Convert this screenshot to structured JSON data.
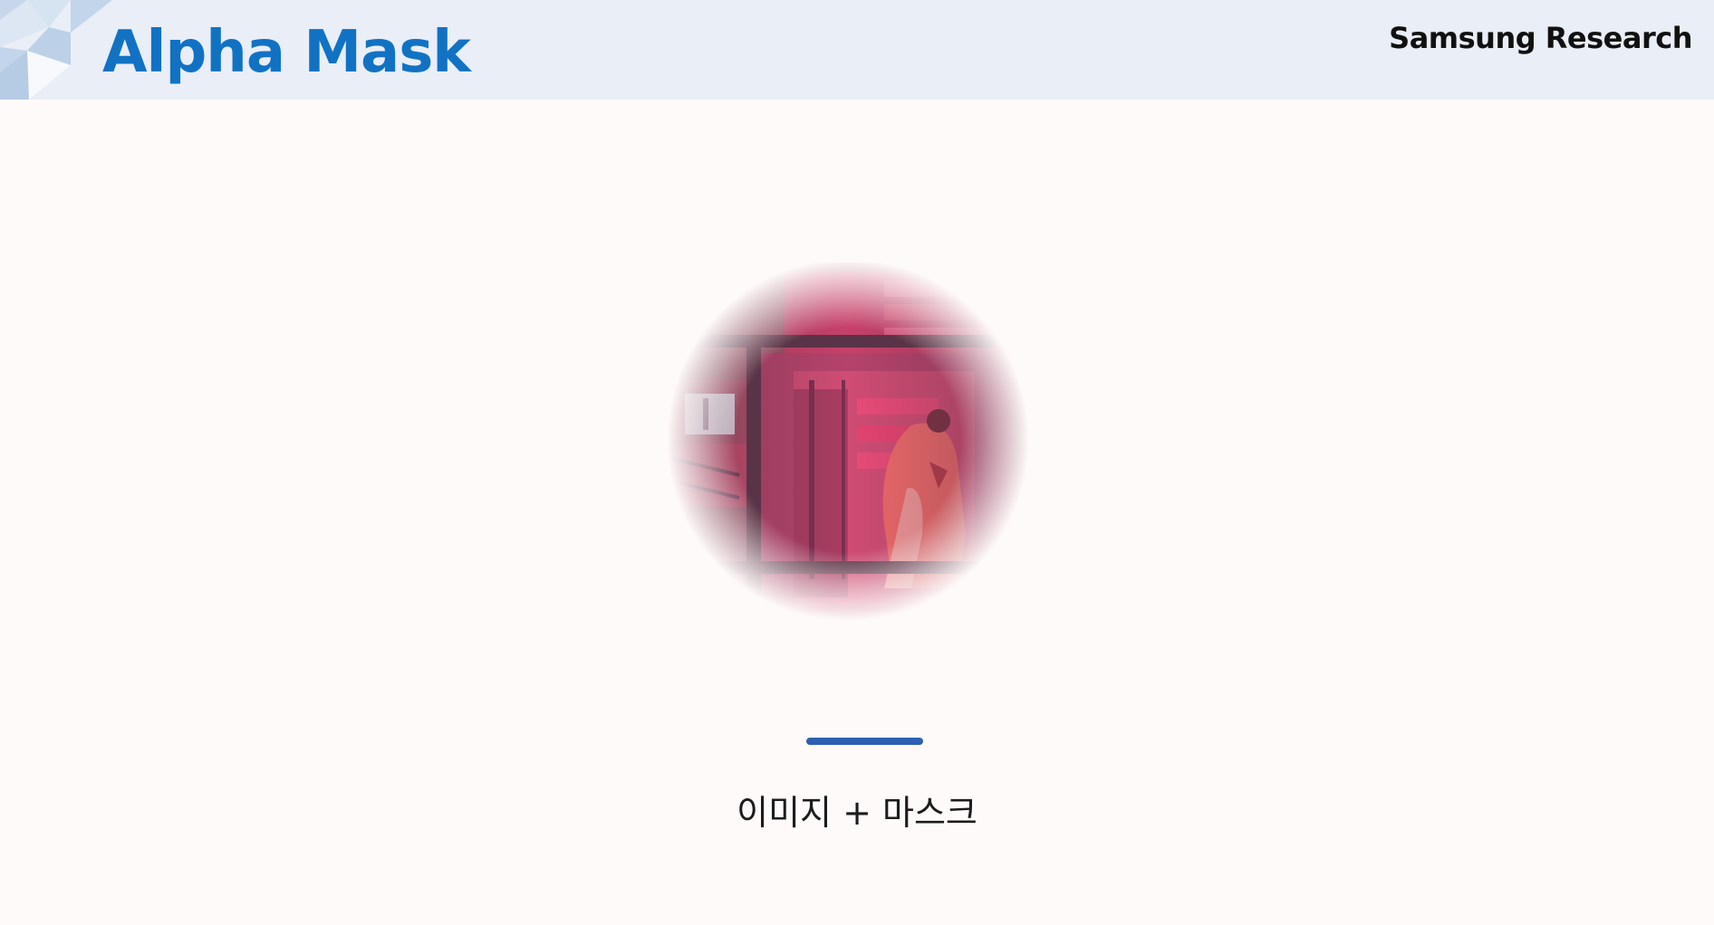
{
  "header": {
    "title": "Alpha Mask",
    "brand": "Samsung Research"
  },
  "main": {
    "caption": "이미지 + 마스크"
  },
  "colors": {
    "header_bg": "#e9eef7",
    "title": "#1172c4",
    "accent": "#2e5fb1",
    "page_bg": "#fefaf9"
  }
}
